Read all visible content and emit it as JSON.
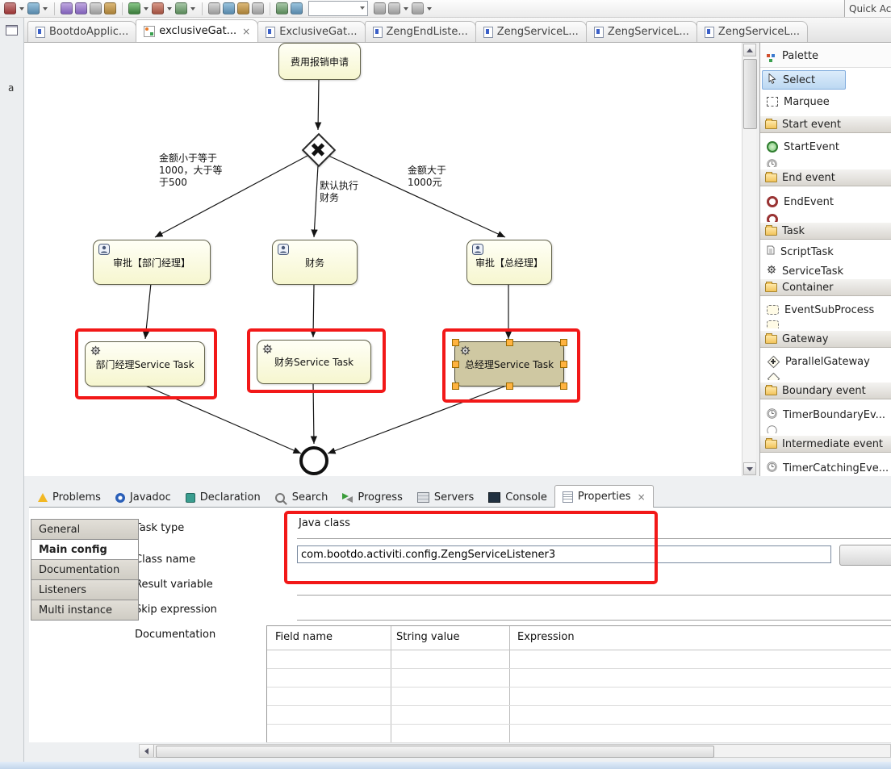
{
  "window": {
    "quick_access": "Quick Access",
    "close_glyph": "×",
    "left_strip_label": "a"
  },
  "toolbar": {
    "icons": [
      "new-icon",
      "new-dropdown",
      "debug-icon",
      "debug-dropdown",
      "run-icon",
      "run-dropdown",
      "save-icon",
      "save-all-icon",
      "print-icon",
      "build-icon",
      "search-icon",
      "external-tools-icon",
      "external-tools-dropdown",
      "coverage-icon",
      "coverage-dropdown",
      "next-annotation-icon",
      "prev-annotation-icon",
      "last-edit-icon",
      "back-icon",
      "forward-icon"
    ]
  },
  "editor_tabs": [
    {
      "label": "BootdoApplic..."
    },
    {
      "label": "exclusiveGat...",
      "active": true
    },
    {
      "label": "ExclusiveGat..."
    },
    {
      "label": "ZengEndListe..."
    },
    {
      "label": "ZengServiceL..."
    },
    {
      "label": "ZengServiceL..."
    },
    {
      "label": "ZengServiceL..."
    }
  ],
  "diagram": {
    "start_node": "费用报销申请",
    "gateway": "exclusive-gateway",
    "branch_labels": {
      "left": "金额小于等于\n1000，大于等\n于500",
      "middle": "默认执行\n财务",
      "right": "金额大于\n1000元"
    },
    "tasks": [
      "审批【部门经理】",
      "财务",
      "审批【总经理】"
    ],
    "service_tasks": [
      "部门经理Service Task",
      "财务Service Task",
      "总经理Service Task"
    ],
    "colors": {
      "node_fill": "#f6f6cf",
      "selected_node_fill": "#cfc8a2",
      "annotation_red": "#f21818",
      "selection_handle": "#ffb340"
    }
  },
  "palette": {
    "title": "Palette",
    "tools": [
      "Select",
      "Marquee"
    ],
    "selected_tool": "Select",
    "groups": [
      {
        "header": "Start event",
        "items": [
          "StartEvent"
        ]
      },
      {
        "header": "End event",
        "items": [
          "EndEvent"
        ]
      },
      {
        "header": "Task",
        "items": [
          "ScriptTask",
          "ServiceTask"
        ]
      },
      {
        "header": "Container",
        "items": [
          "EventSubProcess"
        ]
      },
      {
        "header": "Gateway",
        "items": [
          "ParallelGateway"
        ]
      },
      {
        "header": "Boundary event",
        "items": [
          "TimerBoundaryEv..."
        ]
      },
      {
        "header": "Intermediate event",
        "items": [
          "TimerCatchingEve..."
        ]
      }
    ]
  },
  "bottom_tabs": [
    "Problems",
    "Javadoc",
    "Declaration",
    "Search",
    "Progress",
    "Servers",
    "Console",
    "Properties"
  ],
  "active_bottom_tab": "Properties",
  "properties": {
    "menu": [
      "General",
      "Main config",
      "Documentation",
      "Listeners",
      "Multi instance"
    ],
    "active_menu": "Main config",
    "labels": {
      "task_type": "Task type",
      "class_name": "Class name",
      "result_variable": "Result variable",
      "skip_expression": "Skip expression",
      "documentation": "Documentation"
    },
    "task_type_value": "Java class",
    "class_name_value": "com.bootdo.activiti.config.ZengServiceListener3",
    "fields_table": {
      "columns": [
        "Field name",
        "String value",
        "Expression"
      ]
    }
  }
}
